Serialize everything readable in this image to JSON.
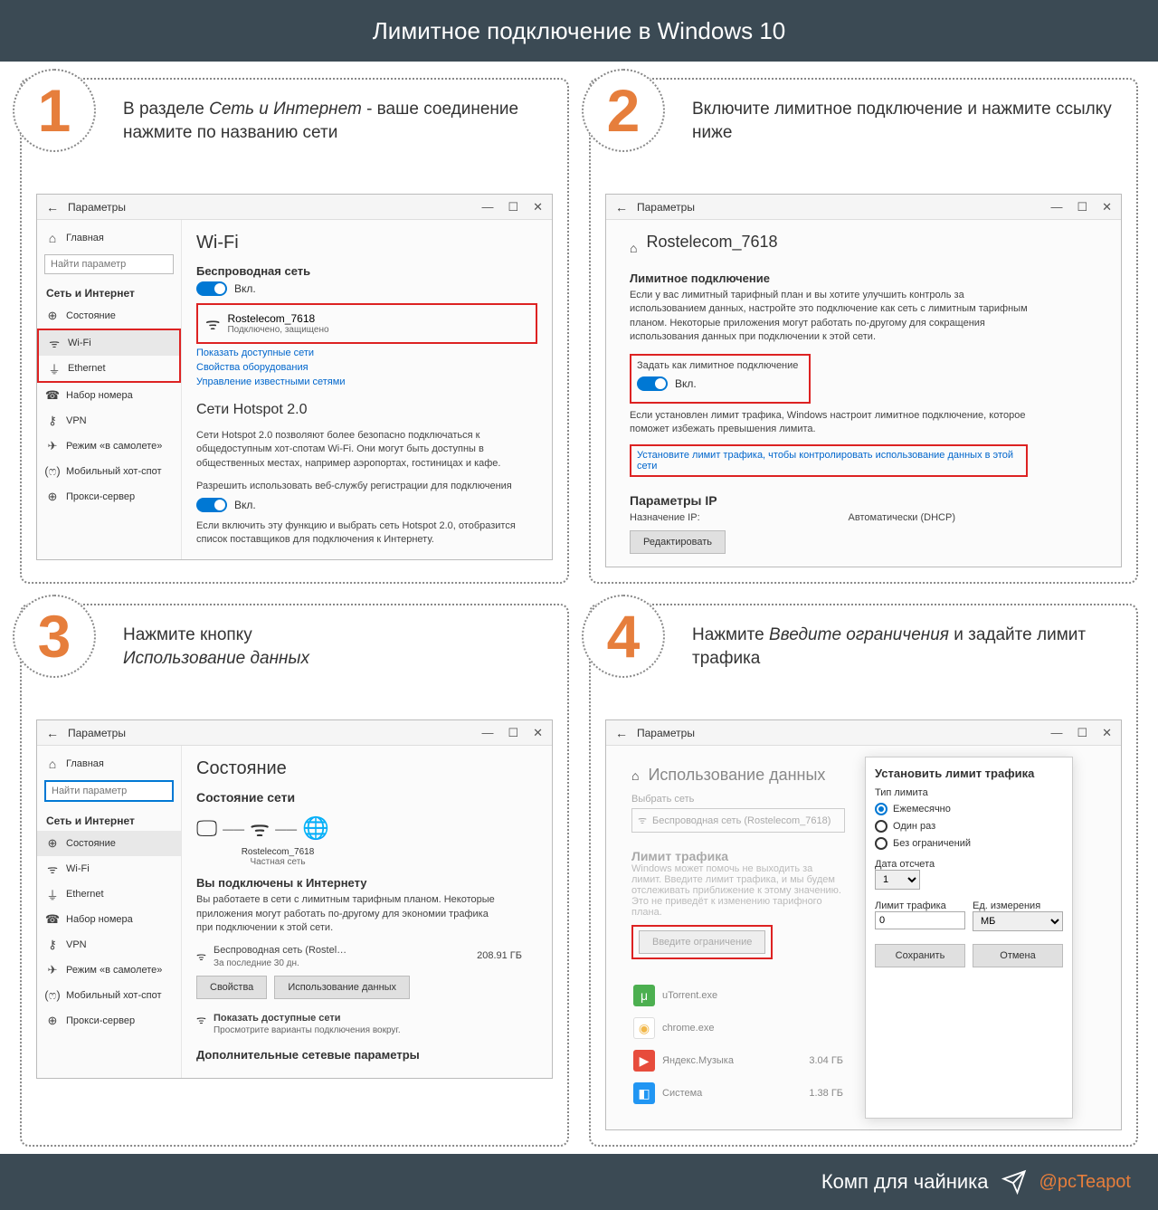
{
  "header": {
    "title": "Лимитное подключение в Windows 10"
  },
  "footer": {
    "label": "Комп для чайника",
    "handle": "@pcTeapot"
  },
  "steps": {
    "s1": {
      "num": "1",
      "desc_pre": "В разделе ",
      "desc_em": "Сеть и Интернет",
      "desc_post": " - ваше соединение нажмите по названию сети"
    },
    "s2": {
      "num": "2",
      "desc": "Включите лимитное подключение и нажмите ссылку ниже"
    },
    "s3": {
      "num": "3",
      "desc_pre": "Нажмите кнопку ",
      "desc_em": "Использование данных"
    },
    "s4": {
      "num": "4",
      "desc_pre": "Нажмите ",
      "desc_em": "Введите ограничения",
      "desc_post": " и задайте лимит трафика"
    }
  },
  "win_common": {
    "app_title": "Параметры",
    "ctrl_min": "—",
    "ctrl_max": "☐",
    "ctrl_close": "✕",
    "back": "←",
    "sidebar": {
      "home": "Главная",
      "search_placeholder": "Найти параметр",
      "section": "Сеть и Интернет",
      "items": [
        {
          "icon": "⊕",
          "label": "Состояние"
        },
        {
          "icon": "ᯤ",
          "label": "Wi-Fi"
        },
        {
          "icon": "⏚",
          "label": "Ethernet"
        },
        {
          "icon": "☎",
          "label": "Набор номера"
        },
        {
          "icon": "⚷",
          "label": "VPN"
        },
        {
          "icon": "✈",
          "label": "Режим «в самолете»"
        },
        {
          "icon": "(ෆ)",
          "label": "Мобильный хот-спот"
        },
        {
          "icon": "⊕",
          "label": "Прокси-сервер"
        }
      ]
    }
  },
  "win1": {
    "h1": "Wi-Fi",
    "wireless_label": "Беспроводная сеть",
    "toggle_on": "Вкл.",
    "net_name": "Rostelecom_7618",
    "net_status": "Подключено, защищено",
    "link_show": "Показать доступные сети",
    "link_props": "Свойства оборудования",
    "link_manage": "Управление известными сетями",
    "h2": "Сети Hotspot 2.0",
    "hs_desc": "Сети Hotspot 2.0 позволяют более безопасно подключаться к общедоступным хот-спотам Wi-Fi. Они могут быть доступны в общественных местах, например аэропортах, гостиницах и кафе.",
    "hs_allow": "Разрешить использовать веб-службу регистрации для подключения",
    "hs_note": "Если включить эту функцию и выбрать сеть Hotspot 2.0, отобразится список поставщиков для подключения к Интернету."
  },
  "win2": {
    "h1": "Rostelecom_7618",
    "h2": "Лимитное подключение",
    "desc": "Если у вас лимитный тарифный план и вы хотите улучшить контроль за использованием данных, настройте это подключение как сеть с лимитным тарифным планом. Некоторые приложения могут работать по-другому для сокращения использования данных при подключении к этой сети.",
    "set_metered": "Задать как лимитное подключение",
    "toggle_on": "Вкл.",
    "metered_note": "Если установлен лимит трафика, Windows настроит лимитное подключение, которое поможет избежать превышения лимита.",
    "set_limit_link": "Установите лимит трафика, чтобы контролировать использование данных в этой сети",
    "ip_h": "Параметры IP",
    "ip_assign_label": "Назначение IP:",
    "ip_assign_value": "Автоматически (DHCP)",
    "edit_btn": "Редактировать"
  },
  "win3": {
    "h1": "Состояние",
    "h2": "Состояние сети",
    "diagram_name": "Rostelecom_7618",
    "diagram_type": "Частная сеть",
    "connected_h": "Вы подключены к Интернету",
    "connected_desc": "Вы работаете в сети с лимитным тарифным планом. Некоторые приложения могут работать по-другому для экономии трафика при подключении к этой сети.",
    "wifi_label": "Беспроводная сеть (Rostel…",
    "period": "За последние 30 дн.",
    "usage_value": "208.91 ГБ",
    "btn_props": "Свойства",
    "btn_usage": "Использование данных",
    "link_show": "Показать доступные сети",
    "link_show_desc": "Просмотрите варианты подключения вокруг.",
    "extra_h": "Дополнительные сетевые параметры"
  },
  "win4": {
    "h1": "Использование данных",
    "select_net_label": "Выбрать сеть",
    "select_net_value": "Беспроводная сеть (Rostelecom_7618)",
    "limit_h": "Лимит трафика",
    "limit_desc": "Windows может помочь не выходить за лимит. Введите лимит трафика, и мы будем отслеживать приближение к этому значению. Это не приведёт к изменению тарифного плана.",
    "btn_enter_limit": "Введите ограничение",
    "apps": [
      {
        "name": "uTorrent.exe",
        "size": "",
        "color": "#4caf50"
      },
      {
        "name": "chrome.exe",
        "size": "",
        "color": "#f2b84b"
      },
      {
        "name": "Яндекс.Музыка",
        "size": "3.04 ГБ",
        "color": "#e74c3c"
      },
      {
        "name": "Система",
        "size": "1.38 ГБ",
        "color": "#2196f3"
      }
    ],
    "dialog": {
      "title": "Установить лимит трафика",
      "type_label": "Тип лимита",
      "opt_monthly": "Ежемесячно",
      "opt_once": "Один раз",
      "opt_unlim": "Без ограничений",
      "date_label": "Дата отсчета",
      "date_value": "1",
      "limit_label": "Лимит трафика",
      "limit_value": "0",
      "unit_label": "Ед. измерения",
      "unit_value": "МБ",
      "btn_save": "Сохранить",
      "btn_cancel": "Отмена"
    }
  }
}
